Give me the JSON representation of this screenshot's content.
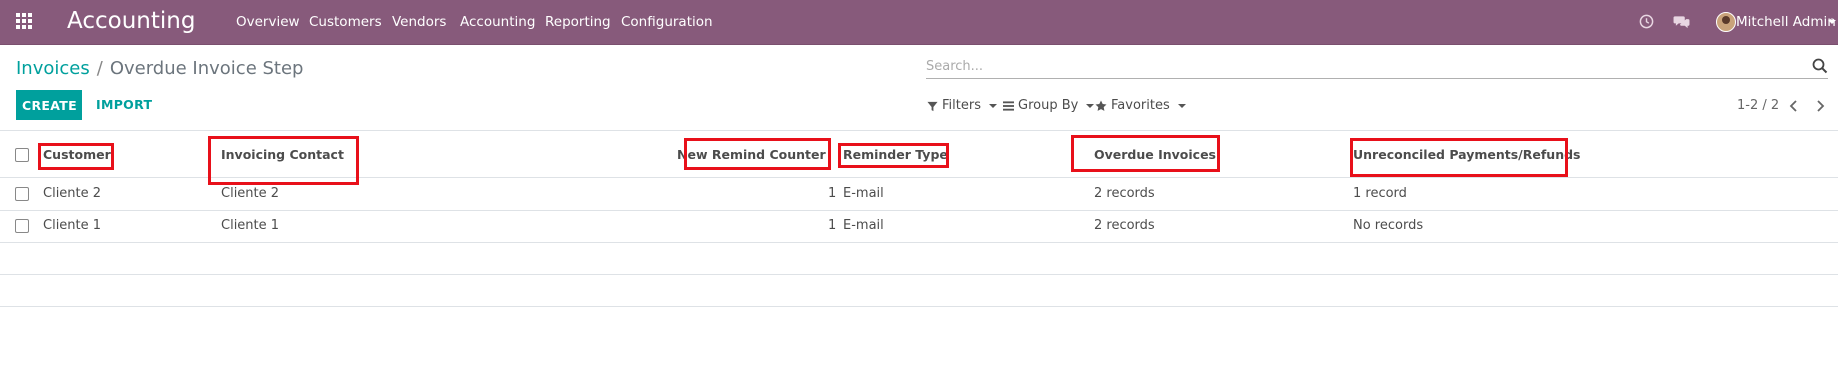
{
  "navbar": {
    "app_title": "Accounting",
    "menu": [
      "Overview",
      "Customers",
      "Vendors",
      "Accounting",
      "Reporting",
      "Configuration"
    ],
    "user_name": "Mitchell Admin",
    "icons": [
      "apps-grid-icon",
      "clock-icon",
      "chat-icon",
      "avatar"
    ]
  },
  "breadcrumb": {
    "parent": "Invoices",
    "separator": "/",
    "current": "Overdue Invoice Step"
  },
  "search": {
    "placeholder": "Search...",
    "value": ""
  },
  "buttons": {
    "create": "CREATE",
    "import": "IMPORT"
  },
  "filters": {
    "filters_label": "Filters",
    "group_by_label": "Group By",
    "favorites_label": "Favorites"
  },
  "pager": {
    "value": "1-2 / 2"
  },
  "table": {
    "columns": [
      "Customer",
      "Invoicing Contact",
      "New Remind Counter",
      "Reminder Type",
      "Overdue Invoices",
      "Unreconciled Payments/Refunds"
    ],
    "rows": [
      {
        "customer": "Cliente 2",
        "invoicing_contact": "Cliente 2",
        "new_remind_counter": "1",
        "reminder_type": "E-mail",
        "overdue_invoices": "2 records",
        "unreconciled": "1 record"
      },
      {
        "customer": "Cliente 1",
        "invoicing_contact": "Cliente 1",
        "new_remind_counter": "1",
        "reminder_type": "E-mail",
        "overdue_invoices": "2 records",
        "unreconciled": "No records"
      }
    ]
  },
  "colors": {
    "navbar": "#875a7b",
    "primary": "#00a09d",
    "highlight": "#e8101a"
  }
}
